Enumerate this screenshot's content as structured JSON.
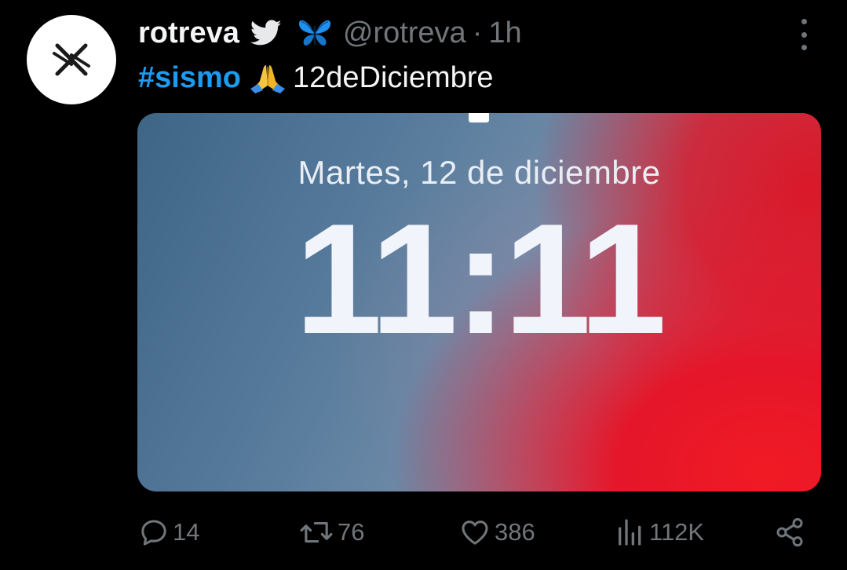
{
  "author": {
    "display_name": "rotreva",
    "handle": "@rotreva",
    "separator": "·",
    "time": "1h",
    "verified_icon": "twitter-bird-icon",
    "emoji_icon": "butterfly-icon"
  },
  "tweet": {
    "hashtag": "#sismo",
    "emoji_icon": "praying-hands-icon",
    "text": "12deDiciembre"
  },
  "media": {
    "lock_screen_date": "Martes, 12 de diciembre",
    "lock_screen_time": "11:11"
  },
  "actions": {
    "replies": "14",
    "retweets": "76",
    "likes": "386",
    "views": "112K"
  },
  "colors": {
    "background": "#000000",
    "hashtag": "#1d9bf0",
    "muted": "#71767b",
    "text": "#e7e9ea"
  }
}
